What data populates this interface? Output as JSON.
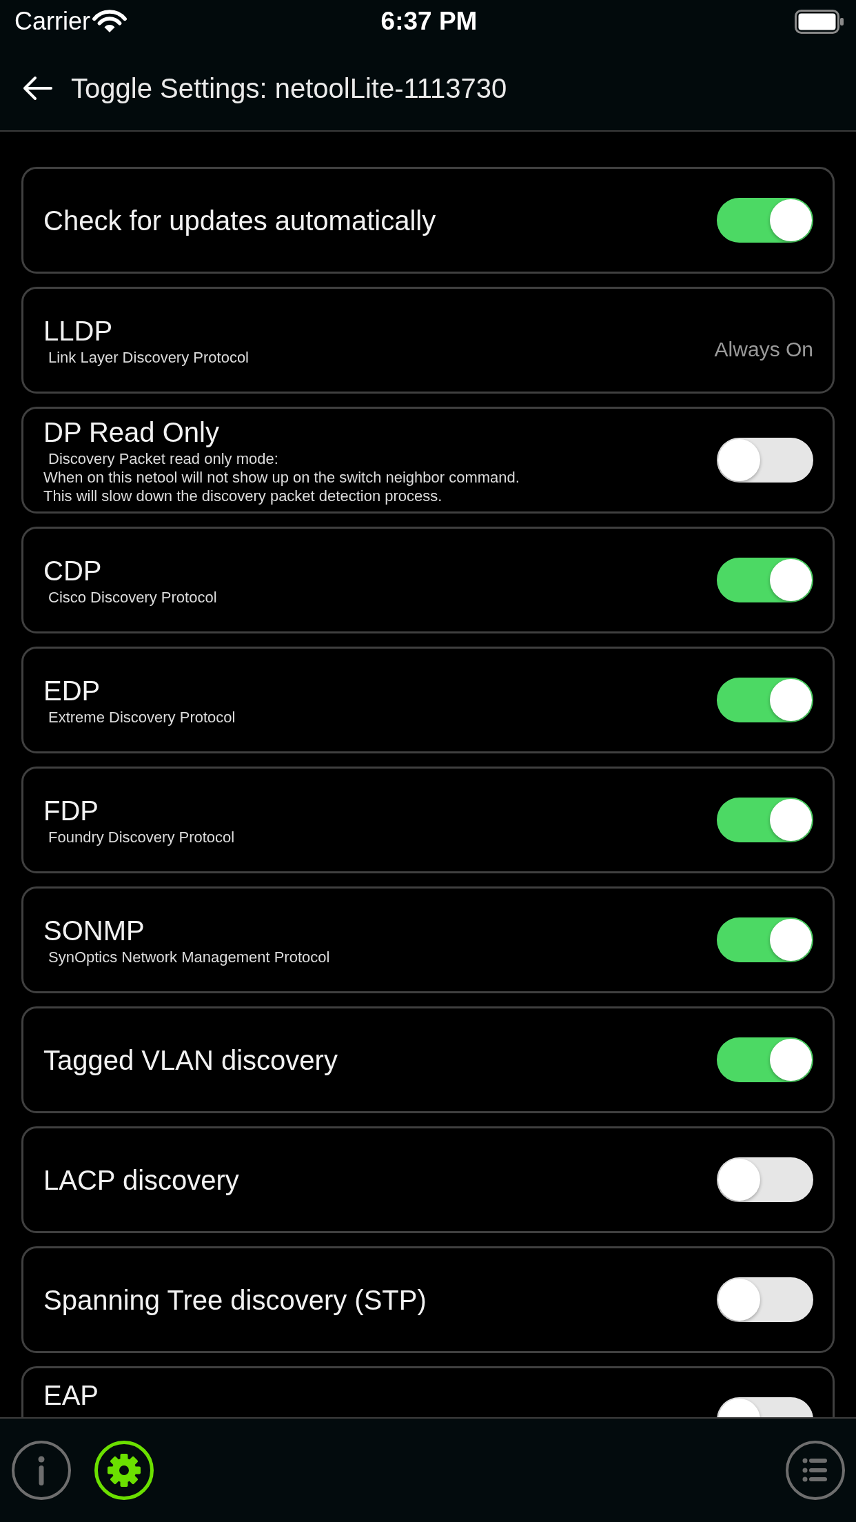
{
  "status_bar": {
    "carrier": "Carrier",
    "time": "6:37 PM"
  },
  "header": {
    "title": "Toggle Settings: netoolLite-1113730"
  },
  "settings": [
    {
      "kind": "toggle",
      "title": "Check for updates automatically",
      "on": true
    },
    {
      "kind": "status",
      "title": "LLDP",
      "subtitle": "Link Layer Discovery Protocol",
      "status": "Always On"
    },
    {
      "kind": "toggle",
      "title": "DP Read Only",
      "subtitle": "Discovery Packet read only mode:\nWhen on this netool will not show up on the switch neighbor command.\nThis will slow down the discovery packet detection process.",
      "on": false
    },
    {
      "kind": "toggle",
      "title": "CDP",
      "subtitle": "Cisco Discovery Protocol",
      "on": true
    },
    {
      "kind": "toggle",
      "title": "EDP",
      "subtitle": "Extreme Discovery Protocol",
      "on": true
    },
    {
      "kind": "toggle",
      "title": "FDP",
      "subtitle": "Foundry Discovery Protocol",
      "on": true
    },
    {
      "kind": "toggle",
      "title": "SONMP",
      "subtitle": "SynOptics Network Management Protocol",
      "on": true
    },
    {
      "kind": "toggle",
      "title": "Tagged VLAN discovery",
      "on": true
    },
    {
      "kind": "toggle",
      "title": "LACP discovery",
      "on": false
    },
    {
      "kind": "toggle",
      "title": "Spanning Tree discovery (STP)",
      "on": false
    },
    {
      "kind": "toggle",
      "title": "EAP",
      "on": false
    }
  ],
  "bottom_bar": {
    "items": [
      {
        "kind": "info",
        "selected": false
      },
      {
        "kind": "settings",
        "selected": true
      },
      {
        "kind": "list",
        "selected": false
      }
    ]
  }
}
